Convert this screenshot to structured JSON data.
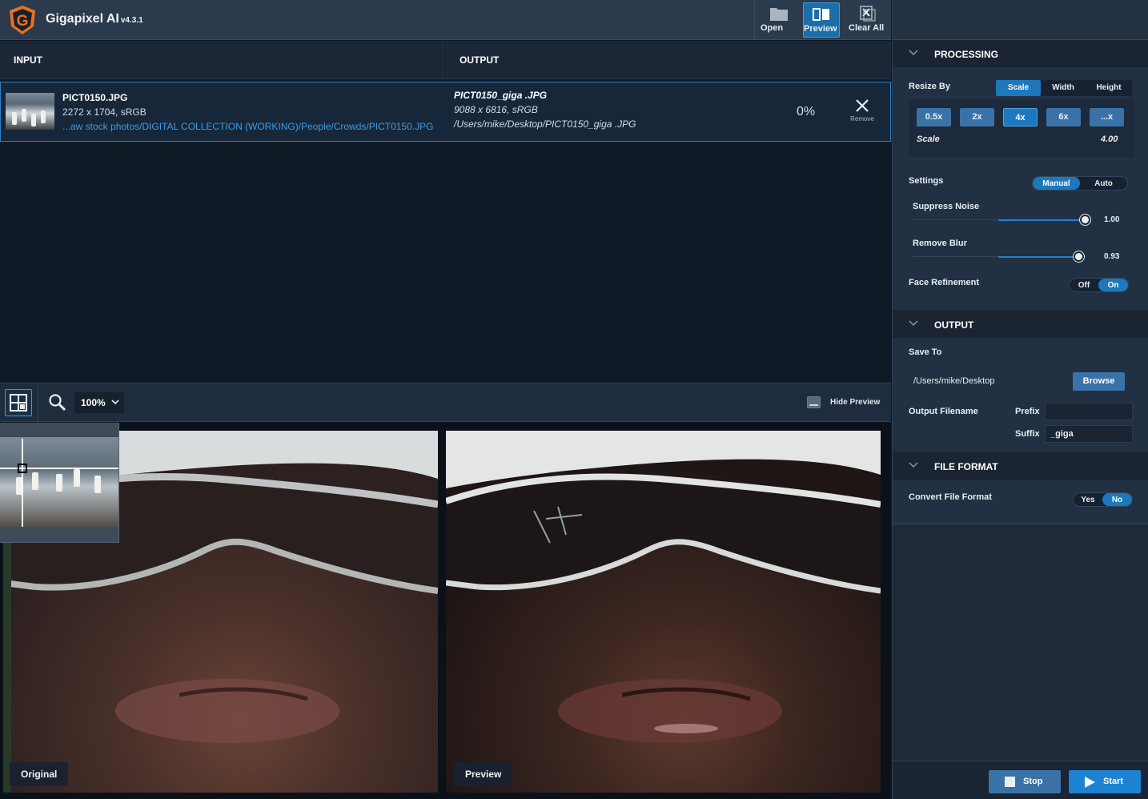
{
  "app": {
    "title": "Gigapixel AI",
    "version": "v4.3.1"
  },
  "toolbar": {
    "open_label": "Open",
    "preview_label": "Preview",
    "clear_label": "Clear All"
  },
  "columns": {
    "input": "INPUT",
    "output": "OUTPUT"
  },
  "file": {
    "in_name": "PICT0150.JPG",
    "in_dims": "2272 x 1704, sRGB",
    "in_path": "...aw stock photos/DIGITAL COLLECTION (WORKING)/People/Crowds/PICT0150.JPG",
    "out_name": "PICT0150_giga .JPG",
    "out_dims": "9088 x 6816, sRGB",
    "out_path": "/Users/mike/Desktop/PICT0150_giga .JPG",
    "progress": "0%",
    "remove_label": "Remove"
  },
  "preview": {
    "zoom": "100%",
    "hide_label": "Hide Preview",
    "original_label": "Original",
    "preview_label": "Preview"
  },
  "processing": {
    "title": "PROCESSING",
    "resize_by_label": "Resize By",
    "resize_options": [
      "Scale",
      "Width",
      "Height"
    ],
    "scale_chips": [
      "0.5x",
      "2x",
      "4x",
      "6x",
      "...x"
    ],
    "scale_label": "Scale",
    "scale_value": "4.00",
    "settings_label": "Settings",
    "settings_options": [
      "Manual",
      "Auto"
    ],
    "suppress_noise_label": "Suppress Noise",
    "suppress_noise_value": "1.00",
    "suppress_noise_level": 1.0,
    "remove_blur_label": "Remove Blur",
    "remove_blur_value": "0.93",
    "remove_blur_level": 0.93,
    "face_refinement_label": "Face Refinement",
    "face_options": [
      "Off",
      "On"
    ]
  },
  "output": {
    "title": "OUTPUT",
    "save_to_label": "Save To",
    "save_path": "/Users/mike/Desktop",
    "browse_label": "Browse",
    "filename_label": "Output Filename",
    "prefix_label": "Prefix",
    "prefix_value": "",
    "suffix_label": "Suffix",
    "suffix_value": "_giga"
  },
  "file_format": {
    "title": "FILE FORMAT",
    "convert_label": "Convert File Format",
    "options": [
      "Yes",
      "No"
    ]
  },
  "actions": {
    "stop_label": "Stop",
    "start_label": "Start"
  },
  "colors": {
    "accent": "#1d78bd",
    "link": "#3a9ce8",
    "logo": "#e8701f"
  }
}
